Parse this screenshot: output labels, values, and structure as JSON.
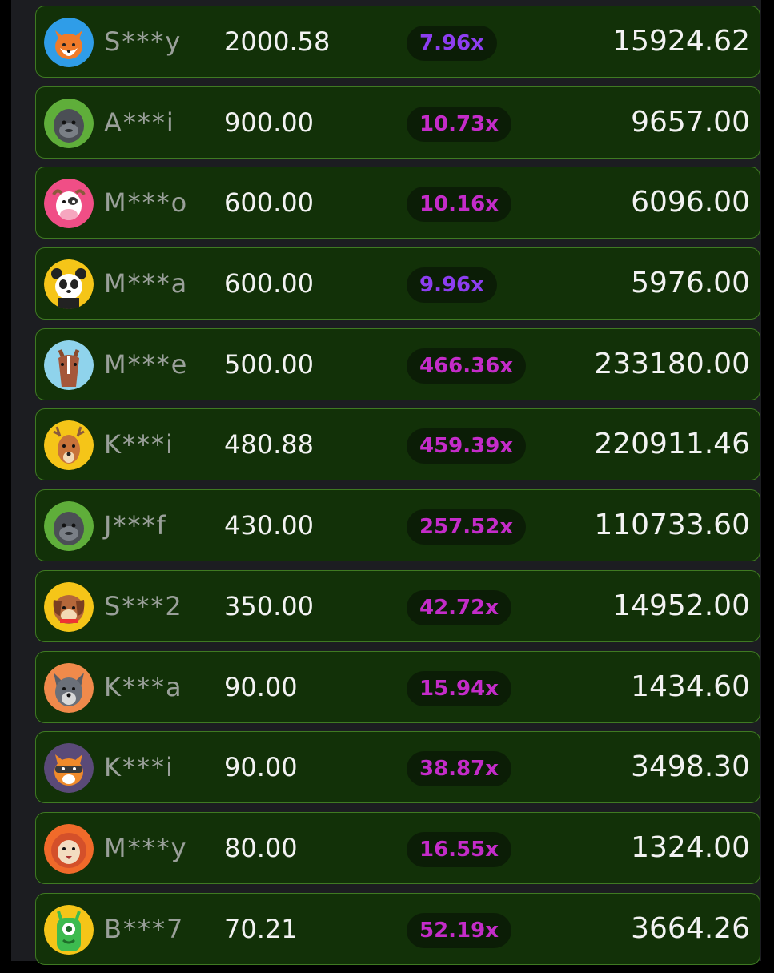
{
  "colors": {
    "row_bg": "#123108",
    "row_border": "#3f7a22",
    "multiplier_violet": "#8d3ef0",
    "multiplier_magenta": "#c42cc9",
    "username": "#9aa09a",
    "amount": "#f2f2f2"
  },
  "bets": [
    {
      "avatar": "fox-avatar",
      "user": "S***y",
      "bet": "2000.58",
      "multiplier": "7.96x",
      "win": "15924.62",
      "mult_color": "violet"
    },
    {
      "avatar": "gorilla-avatar",
      "user": "A***i",
      "bet": "900.00",
      "multiplier": "10.73x",
      "win": "9657.00",
      "mult_color": "magenta"
    },
    {
      "avatar": "cow-avatar",
      "user": "M***o",
      "bet": "600.00",
      "multiplier": "10.16x",
      "win": "6096.00",
      "mult_color": "magenta"
    },
    {
      "avatar": "panda-avatar",
      "user": "M***a",
      "bet": "600.00",
      "multiplier": "9.96x",
      "win": "5976.00",
      "mult_color": "violet"
    },
    {
      "avatar": "horse-avatar",
      "user": "M***e",
      "bet": "500.00",
      "multiplier": "466.36x",
      "win": "233180.00",
      "mult_color": "magenta"
    },
    {
      "avatar": "deer-avatar",
      "user": "K***i",
      "bet": "480.88",
      "multiplier": "459.39x",
      "win": "220911.46",
      "mult_color": "magenta"
    },
    {
      "avatar": "gorilla-avatar",
      "user": "J***f",
      "bet": "430.00",
      "multiplier": "257.52x",
      "win": "110733.60",
      "mult_color": "magenta"
    },
    {
      "avatar": "dog-avatar",
      "user": "S***2",
      "bet": "350.00",
      "multiplier": "42.72x",
      "win": "14952.00",
      "mult_color": "magenta"
    },
    {
      "avatar": "wolf-avatar",
      "user": "K***a",
      "bet": "90.00",
      "multiplier": "15.94x",
      "win": "1434.60",
      "mult_color": "magenta"
    },
    {
      "avatar": "raccoon-avatar",
      "user": "K***i",
      "bet": "90.00",
      "multiplier": "38.87x",
      "win": "3498.30",
      "mult_color": "magenta"
    },
    {
      "avatar": "lion-avatar",
      "user": "M***y",
      "bet": "80.00",
      "multiplier": "16.55x",
      "win": "1324.00",
      "mult_color": "magenta"
    },
    {
      "avatar": "monster-avatar",
      "user": "B***7",
      "bet": "70.21",
      "multiplier": "52.19x",
      "win": "3664.26",
      "mult_color": "magenta"
    }
  ]
}
